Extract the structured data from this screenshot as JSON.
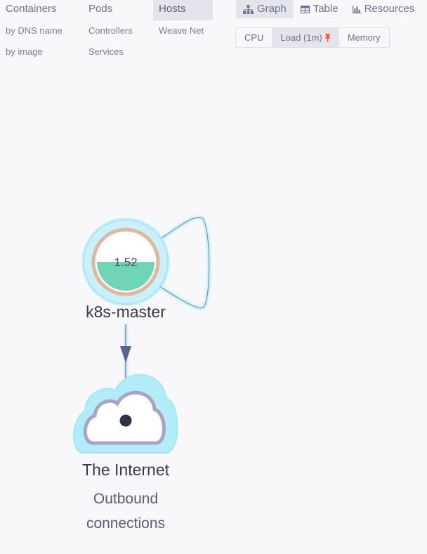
{
  "topology": {
    "containers": {
      "label": "Containers",
      "subs": [
        "by DNS name",
        "by image"
      ]
    },
    "pods": {
      "label": "Pods",
      "subs": [
        "Controllers",
        "Services"
      ]
    },
    "hosts": {
      "label": "Hosts",
      "subs": [
        "Weave Net"
      ],
      "active": true
    }
  },
  "view_modes": [
    {
      "label": "Graph",
      "icon": "graph-icon",
      "active": true
    },
    {
      "label": "Table",
      "icon": "table-icon",
      "active": false
    },
    {
      "label": "Resources",
      "icon": "bar-chart-icon",
      "active": false
    }
  ],
  "metrics": [
    {
      "label": "CPU",
      "active": false
    },
    {
      "label": "Load (1m)",
      "active": true,
      "pinned": true
    },
    {
      "label": "Memory",
      "active": false
    }
  ],
  "nodes": {
    "host": {
      "label": "k8s-master",
      "value": "1.52",
      "fill_fraction": 0.5
    },
    "internet": {
      "label": "The Internet",
      "sublabel_line1": "Outbound",
      "sublabel_line2": "connections"
    }
  },
  "colors": {
    "accent_pin": "#ff5a3d",
    "node_halo": "#aee9f7",
    "node_fill": "#6fd5b7",
    "node_ring": "#e0b6a0",
    "cloud_stroke": "#a9a4c6",
    "edge": "#6b6d96"
  }
}
